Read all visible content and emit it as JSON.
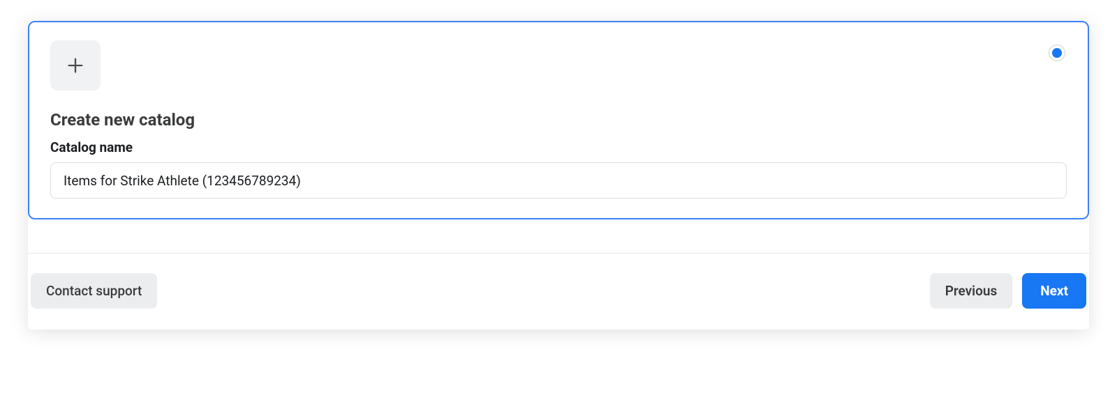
{
  "card": {
    "title": "Create new catalog",
    "name_label": "Catalog name",
    "name_value": "Items for Strike Athlete (123456789234)",
    "name_placeholder": ""
  },
  "footer": {
    "contact_label": "Contact support",
    "previous_label": "Previous",
    "next_label": "Next"
  }
}
